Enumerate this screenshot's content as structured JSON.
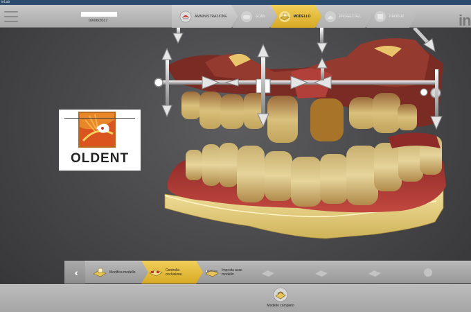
{
  "window": {
    "title": "inLab"
  },
  "header": {
    "date": "09/06/2017",
    "brand": "in",
    "steps": [
      {
        "label": "AMMINISTRAZIONE",
        "state": "done",
        "icon": "crown-icon"
      },
      {
        "label": "SCAN",
        "state": "disabled",
        "icon": "scanner-icon"
      },
      {
        "label": "MODELLO",
        "state": "active",
        "icon": "model-icon"
      },
      {
        "label": "PROGETTAZ.",
        "state": "disabled",
        "icon": "design-icon"
      },
      {
        "label": "PRODUZ.",
        "state": "disabled",
        "icon": "mill-icon"
      }
    ]
  },
  "logo": {
    "text": "OLDENT"
  },
  "toolbar": {
    "back_label": "‹‹",
    "tools": [
      {
        "label": "Modifica modello",
        "state": "normal",
        "icon": "edit-model-icon"
      },
      {
        "label": "Controlla occlusione",
        "state": "active",
        "icon": "occlusion-icon"
      },
      {
        "label": "Imposta asse modello",
        "state": "normal",
        "icon": "axis-icon"
      }
    ]
  },
  "status": {
    "label": "Modello completo",
    "icon": "model-complete-icon"
  },
  "colors": {
    "accent": "#e2b530",
    "gum": "#b2403a",
    "base": "#ecd78f",
    "tooth": "#d8c184"
  }
}
